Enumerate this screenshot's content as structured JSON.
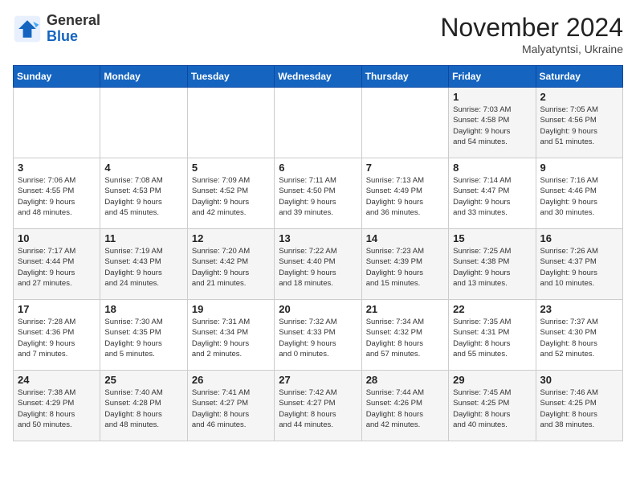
{
  "header": {
    "logo_line1": "General",
    "logo_line2": "Blue",
    "month": "November 2024",
    "location": "Malyatyntsi, Ukraine"
  },
  "weekdays": [
    "Sunday",
    "Monday",
    "Tuesday",
    "Wednesday",
    "Thursday",
    "Friday",
    "Saturday"
  ],
  "weeks": [
    [
      {
        "day": "",
        "info": ""
      },
      {
        "day": "",
        "info": ""
      },
      {
        "day": "",
        "info": ""
      },
      {
        "day": "",
        "info": ""
      },
      {
        "day": "",
        "info": ""
      },
      {
        "day": "1",
        "info": "Sunrise: 7:03 AM\nSunset: 4:58 PM\nDaylight: 9 hours\nand 54 minutes."
      },
      {
        "day": "2",
        "info": "Sunrise: 7:05 AM\nSunset: 4:56 PM\nDaylight: 9 hours\nand 51 minutes."
      }
    ],
    [
      {
        "day": "3",
        "info": "Sunrise: 7:06 AM\nSunset: 4:55 PM\nDaylight: 9 hours\nand 48 minutes."
      },
      {
        "day": "4",
        "info": "Sunrise: 7:08 AM\nSunset: 4:53 PM\nDaylight: 9 hours\nand 45 minutes."
      },
      {
        "day": "5",
        "info": "Sunrise: 7:09 AM\nSunset: 4:52 PM\nDaylight: 9 hours\nand 42 minutes."
      },
      {
        "day": "6",
        "info": "Sunrise: 7:11 AM\nSunset: 4:50 PM\nDaylight: 9 hours\nand 39 minutes."
      },
      {
        "day": "7",
        "info": "Sunrise: 7:13 AM\nSunset: 4:49 PM\nDaylight: 9 hours\nand 36 minutes."
      },
      {
        "day": "8",
        "info": "Sunrise: 7:14 AM\nSunset: 4:47 PM\nDaylight: 9 hours\nand 33 minutes."
      },
      {
        "day": "9",
        "info": "Sunrise: 7:16 AM\nSunset: 4:46 PM\nDaylight: 9 hours\nand 30 minutes."
      }
    ],
    [
      {
        "day": "10",
        "info": "Sunrise: 7:17 AM\nSunset: 4:44 PM\nDaylight: 9 hours\nand 27 minutes."
      },
      {
        "day": "11",
        "info": "Sunrise: 7:19 AM\nSunset: 4:43 PM\nDaylight: 9 hours\nand 24 minutes."
      },
      {
        "day": "12",
        "info": "Sunrise: 7:20 AM\nSunset: 4:42 PM\nDaylight: 9 hours\nand 21 minutes."
      },
      {
        "day": "13",
        "info": "Sunrise: 7:22 AM\nSunset: 4:40 PM\nDaylight: 9 hours\nand 18 minutes."
      },
      {
        "day": "14",
        "info": "Sunrise: 7:23 AM\nSunset: 4:39 PM\nDaylight: 9 hours\nand 15 minutes."
      },
      {
        "day": "15",
        "info": "Sunrise: 7:25 AM\nSunset: 4:38 PM\nDaylight: 9 hours\nand 13 minutes."
      },
      {
        "day": "16",
        "info": "Sunrise: 7:26 AM\nSunset: 4:37 PM\nDaylight: 9 hours\nand 10 minutes."
      }
    ],
    [
      {
        "day": "17",
        "info": "Sunrise: 7:28 AM\nSunset: 4:36 PM\nDaylight: 9 hours\nand 7 minutes."
      },
      {
        "day": "18",
        "info": "Sunrise: 7:30 AM\nSunset: 4:35 PM\nDaylight: 9 hours\nand 5 minutes."
      },
      {
        "day": "19",
        "info": "Sunrise: 7:31 AM\nSunset: 4:34 PM\nDaylight: 9 hours\nand 2 minutes."
      },
      {
        "day": "20",
        "info": "Sunrise: 7:32 AM\nSunset: 4:33 PM\nDaylight: 9 hours\nand 0 minutes."
      },
      {
        "day": "21",
        "info": "Sunrise: 7:34 AM\nSunset: 4:32 PM\nDaylight: 8 hours\nand 57 minutes."
      },
      {
        "day": "22",
        "info": "Sunrise: 7:35 AM\nSunset: 4:31 PM\nDaylight: 8 hours\nand 55 minutes."
      },
      {
        "day": "23",
        "info": "Sunrise: 7:37 AM\nSunset: 4:30 PM\nDaylight: 8 hours\nand 52 minutes."
      }
    ],
    [
      {
        "day": "24",
        "info": "Sunrise: 7:38 AM\nSunset: 4:29 PM\nDaylight: 8 hours\nand 50 minutes."
      },
      {
        "day": "25",
        "info": "Sunrise: 7:40 AM\nSunset: 4:28 PM\nDaylight: 8 hours\nand 48 minutes."
      },
      {
        "day": "26",
        "info": "Sunrise: 7:41 AM\nSunset: 4:27 PM\nDaylight: 8 hours\nand 46 minutes."
      },
      {
        "day": "27",
        "info": "Sunrise: 7:42 AM\nSunset: 4:27 PM\nDaylight: 8 hours\nand 44 minutes."
      },
      {
        "day": "28",
        "info": "Sunrise: 7:44 AM\nSunset: 4:26 PM\nDaylight: 8 hours\nand 42 minutes."
      },
      {
        "day": "29",
        "info": "Sunrise: 7:45 AM\nSunset: 4:25 PM\nDaylight: 8 hours\nand 40 minutes."
      },
      {
        "day": "30",
        "info": "Sunrise: 7:46 AM\nSunset: 4:25 PM\nDaylight: 8 hours\nand 38 minutes."
      }
    ]
  ]
}
